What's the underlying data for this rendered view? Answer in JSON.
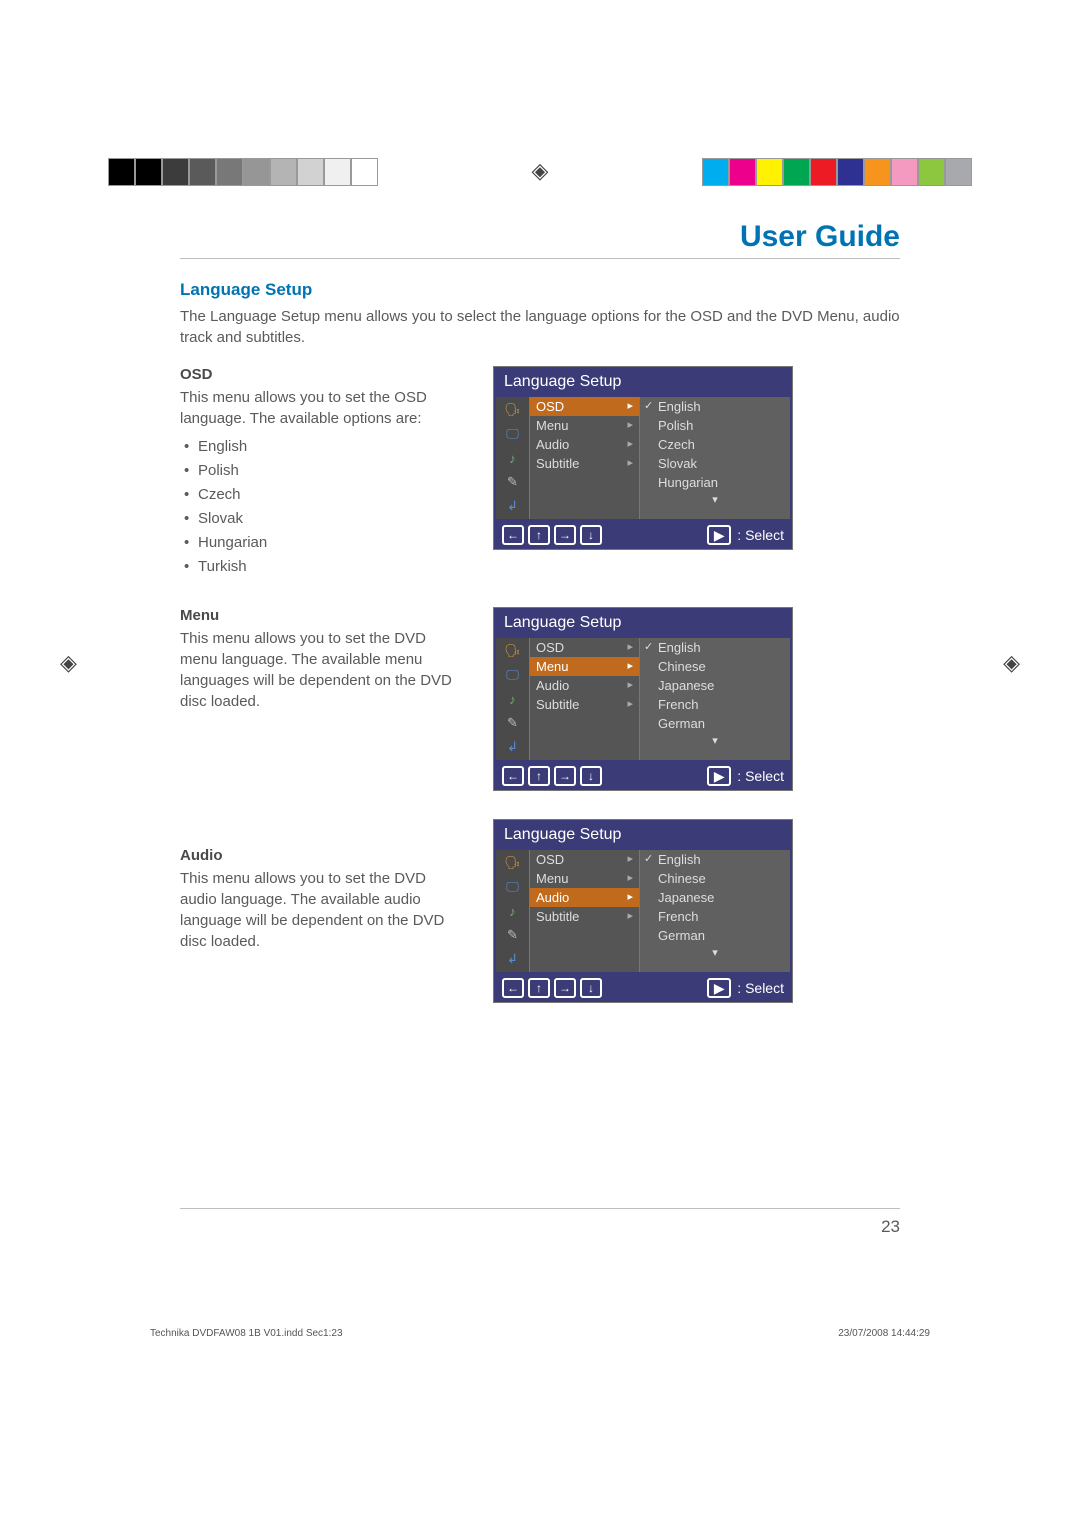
{
  "header": {
    "title": "User Guide"
  },
  "section": {
    "title": "Language Setup",
    "intro": "The Language Setup menu allows you to select the language options for the OSD and the DVD Menu, audio track and subtitles."
  },
  "osd_block": {
    "title": "OSD",
    "desc": "This menu allows you to set the OSD language. The available options are:",
    "bullets": [
      "English",
      "Polish",
      "Czech",
      "Slovak",
      "Hungarian",
      "Turkish"
    ]
  },
  "menu_block": {
    "title": "Menu",
    "desc": "This menu allows you to set the DVD menu language. The available menu languages will be dependent on the DVD disc loaded."
  },
  "audio_block": {
    "title": "Audio",
    "desc": "This menu allows you to set the DVD audio language. The available audio language will be dependent on the DVD disc loaded."
  },
  "screens": {
    "title": "Language Setup",
    "footer_select": ": Select",
    "items": [
      "OSD",
      "Menu",
      "Audio",
      "Subtitle"
    ],
    "s1": {
      "highlight": 0,
      "options": [
        "English",
        "Polish",
        "Czech",
        "Slovak",
        "Hungarian"
      ]
    },
    "s2": {
      "highlight": 1,
      "options": [
        "English",
        "Chinese",
        "Japanese",
        "French",
        "German"
      ]
    },
    "s3": {
      "highlight": 2,
      "options": [
        "English",
        "Chinese",
        "Japanese",
        "French",
        "German"
      ]
    }
  },
  "colors": {
    "calib_left": [
      "#000000",
      "#000000",
      "#3c3c3c",
      "#5a5a5a",
      "#787878",
      "#969696",
      "#b4b4b4",
      "#d2d2d2",
      "#f0f0f0",
      "#ffffff"
    ],
    "calib_right": [
      "#00aeef",
      "#ec008c",
      "#fff200",
      "#00a651",
      "#ed1c24",
      "#2e3192",
      "#f7941d",
      "#f49ac1",
      "#8dc63f",
      "#a7a9ac"
    ]
  },
  "footer": {
    "page_number": "23"
  },
  "meta": {
    "file": "Technika DVDFAW08 1B V01.indd   Sec1:23",
    "timestamp": "23/07/2008   14:44:29"
  }
}
